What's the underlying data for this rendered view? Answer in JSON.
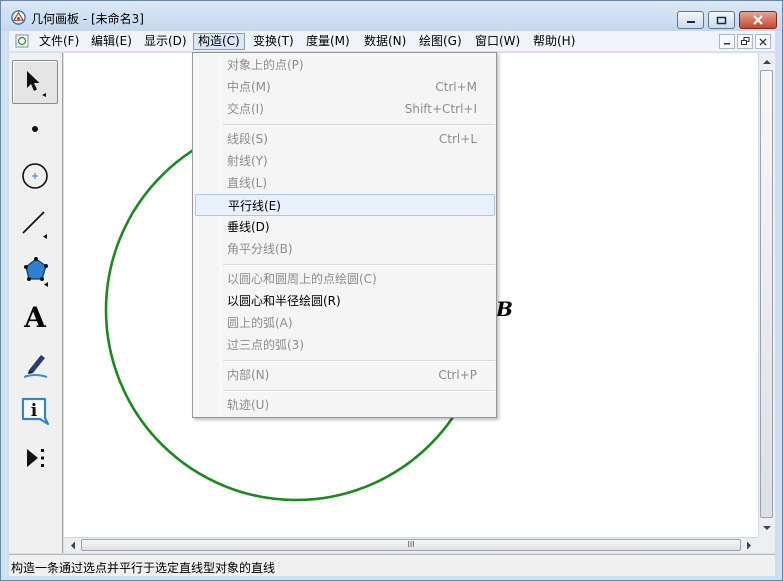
{
  "window": {
    "title": "几何画板 - [未命名3]"
  },
  "menubar": {
    "items": [
      {
        "label": "文件(F)"
      },
      {
        "label": "编辑(E)"
      },
      {
        "label": "显示(D)"
      },
      {
        "label": "构造(C)"
      },
      {
        "label": "变换(T)"
      },
      {
        "label": "度量(M)"
      },
      {
        "label": "数据(N)"
      },
      {
        "label": "绘图(G)"
      },
      {
        "label": "窗口(W)"
      },
      {
        "label": "帮助(H)"
      }
    ],
    "active_index": 3
  },
  "toolbox": {
    "tools": [
      {
        "name": "arrow-select-tool",
        "selected": true
      },
      {
        "name": "point-tool"
      },
      {
        "name": "compass-tool"
      },
      {
        "name": "straightedge-tool"
      },
      {
        "name": "polygon-tool"
      },
      {
        "name": "text-tool",
        "glyph": "A"
      },
      {
        "name": "marker-tool"
      },
      {
        "name": "information-tool",
        "glyph": "i"
      },
      {
        "name": "custom-tool"
      }
    ]
  },
  "canvas": {
    "point_label": "B",
    "circle_color": "#1a8a1a"
  },
  "construct_menu": {
    "items": [
      {
        "label": "对象上的点(P)",
        "shortcut": "",
        "enabled": false
      },
      {
        "label": "中点(M)",
        "shortcut": "Ctrl+M",
        "enabled": false
      },
      {
        "label": "交点(I)",
        "shortcut": "Shift+Ctrl+I",
        "enabled": false
      },
      {
        "label": "线段(S)",
        "shortcut": "Ctrl+L",
        "enabled": false
      },
      {
        "label": "射线(Y)",
        "shortcut": "",
        "enabled": false
      },
      {
        "label": "直线(L)",
        "shortcut": "",
        "enabled": false
      },
      {
        "label": "平行线(E)",
        "shortcut": "",
        "enabled": true,
        "highlighted": true
      },
      {
        "label": "垂线(D)",
        "shortcut": "",
        "enabled": true
      },
      {
        "label": "角平分线(B)",
        "shortcut": "",
        "enabled": false
      },
      {
        "label": "以圆心和圆周上的点绘圆(C)",
        "shortcut": "",
        "enabled": false
      },
      {
        "label": "以圆心和半径绘圆(R)",
        "shortcut": "",
        "enabled": true
      },
      {
        "label": "圆上的弧(A)",
        "shortcut": "",
        "enabled": false
      },
      {
        "label": "过三点的弧(3)",
        "shortcut": "",
        "enabled": false
      },
      {
        "label": "内部(N)",
        "shortcut": "Ctrl+P",
        "enabled": false
      },
      {
        "label": "轨迹(U)",
        "shortcut": "",
        "enabled": false
      }
    ]
  },
  "hscroll": {
    "grip": "III"
  },
  "statusbar": {
    "text": "构造一条通过选点并平行于选定直线型对象的直线"
  }
}
